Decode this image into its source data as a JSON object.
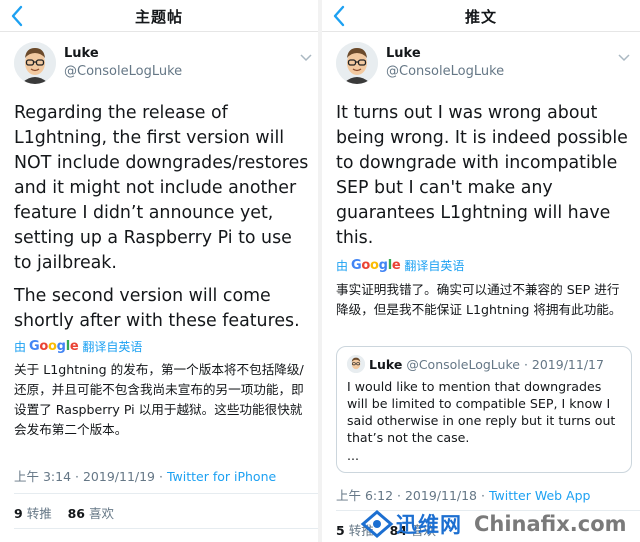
{
  "left": {
    "nav_title": "主题帖",
    "author_name": "Luke",
    "author_handle": "@ConsoleLogLuke",
    "tweet_en_p1": "Regarding the release of L1ghtning, the first version will NOT include downgrades/restores and it might not include another feature I didn’t announce yet, setting up a Raspberry Pi to use to jailbreak.",
    "tweet_en_p2": "The second version will come shortly after with these features.",
    "translate_by": "由",
    "translate_label": "翻译自英语",
    "tweet_zh": "关于 L1ghtning 的发布，第一个版本将不包括降级/还原，并且可能不包含我尚未宣布的另一项功能，即设置了 Raspberry Pi 以用于越狱。这些功能很快就会发布第二个版本。",
    "time": "上午 3:14 · 2019/11/19 ·",
    "source": "Twitter for iPhone",
    "retweet_count": "9",
    "retweet_label": "转推",
    "like_count": "86",
    "like_label": "喜欢"
  },
  "right": {
    "nav_title": "推文",
    "author_name": "Luke",
    "author_handle": "@ConsoleLogLuke",
    "tweet_en": "It turns out I was wrong about being wrong. It is indeed possible to downgrade with incompatible SEP but I can't make any guarantees L1ghtning will have this.",
    "translate_by": "由",
    "translate_label": "翻译自英语",
    "tweet_zh": "事实证明我错了。确实可以通过不兼容的 SEP 进行降级，但是我不能保证 L1ghtning 将拥有此功能。",
    "quote_name": "Luke",
    "quote_handle": "@ConsoleLogLuke",
    "quote_date": "· 2019/11/17",
    "quote_text": "I would like to mention that downgrades will be limited to compatible SEP, I know I said otherwise in one reply but it turns out that’s not the case.",
    "quote_ellipsis": "...",
    "time": "上午 6:12 · 2019/11/18 ·",
    "source": "Twitter Web App",
    "retweet_count": "5",
    "retweet_label": "转推",
    "like_count": "84",
    "like_label": "喜欢"
  },
  "google": [
    "G",
    "o",
    "o",
    "g",
    "l",
    "e"
  ],
  "watermark": {
    "cn": "迅维网",
    "en": "Chinafix.com"
  },
  "colors": {
    "accent": "#1da1f2",
    "secondary_text": "#657786",
    "primary_text": "#14171a"
  }
}
